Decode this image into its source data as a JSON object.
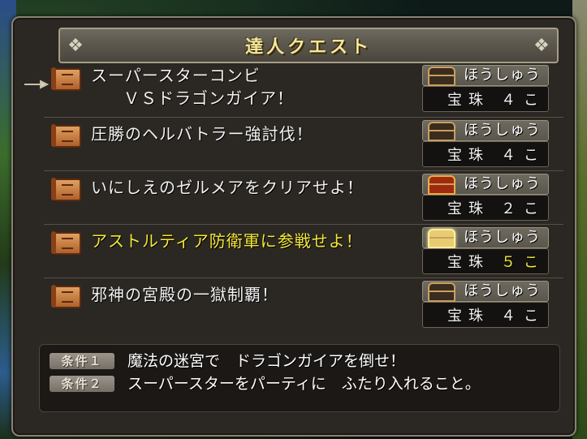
{
  "window": {
    "title": "達人クエスト",
    "reward_header_label": "ほうしゅう"
  },
  "quests": [
    {
      "title_line1": "スーパースターコンビ",
      "title_line2": "ＶＳドラゴンガイア！",
      "reward_item": "宝珠",
      "reward_count": "４こ",
      "chest": "dark",
      "selected": true,
      "highlighted": false
    },
    {
      "title_line1": "圧勝のヘルバトラー強討伐！",
      "reward_item": "宝珠",
      "reward_count": "４こ",
      "chest": "dark",
      "selected": false,
      "highlighted": false
    },
    {
      "title_line1": "いにしえのゼルメアをクリアせよ！",
      "reward_item": "宝珠",
      "reward_count": "２こ",
      "chest": "red",
      "selected": false,
      "highlighted": false
    },
    {
      "title_line1": "アストルティア防衛軍に参戦せよ！",
      "reward_item": "宝珠",
      "reward_count": "５こ",
      "chest": "gold",
      "selected": false,
      "highlighted": true
    },
    {
      "title_line1": "邪神の宮殿の一獄制覇！",
      "reward_item": "宝珠",
      "reward_count": "４こ",
      "chest": "dark",
      "selected": false,
      "highlighted": false
    }
  ],
  "conditions": [
    {
      "badge": "条件１",
      "text": "魔法の迷宮で　ドラゴンガイアを倒せ！"
    },
    {
      "badge": "条件２",
      "text": "スーパースターをパーティに　ふたり入れること。"
    }
  ],
  "colors": {
    "title_gold": "#f4e79a",
    "highlight_yellow": "#f2e83a",
    "text_white": "#f2f2f2",
    "panel_dark": "#2b2722"
  }
}
